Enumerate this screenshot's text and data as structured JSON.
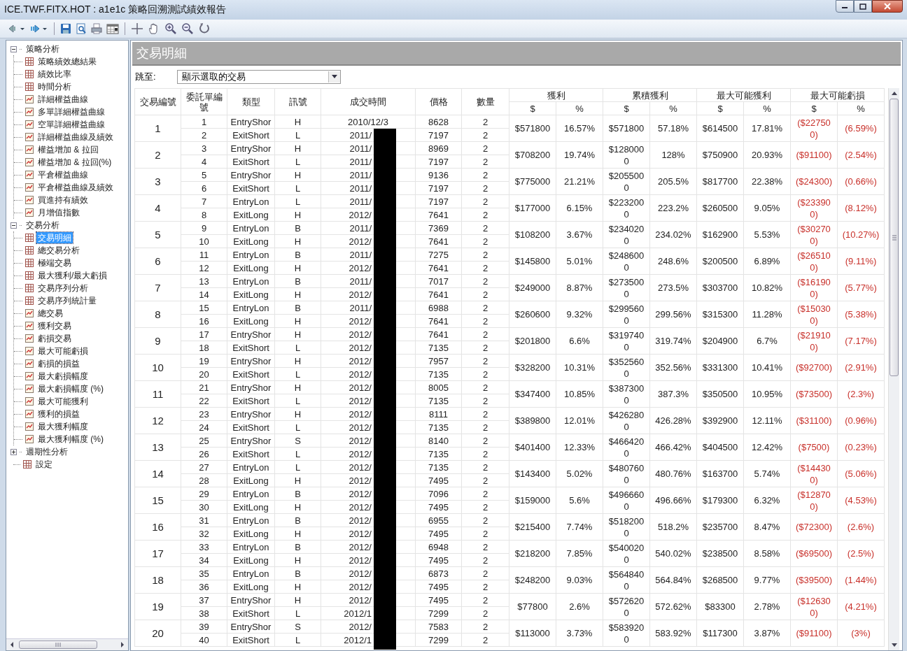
{
  "window": {
    "title": "ICE.TWF.FITX.HOT : a1e1c 策略回溯測試績效報告"
  },
  "sidebar": {
    "items": [
      {
        "label": "策略分析",
        "expanded": true,
        "selected": false,
        "children": [
          {
            "label": "策略績效總結果",
            "kind": "table",
            "selected": false
          },
          {
            "label": "績效比率",
            "kind": "table",
            "selected": false
          },
          {
            "label": "時間分析",
            "kind": "table",
            "selected": false
          },
          {
            "label": "詳細權益曲線",
            "kind": "chart",
            "selected": false
          },
          {
            "label": "多單詳細權益曲線",
            "kind": "chart",
            "selected": false
          },
          {
            "label": "空單詳細權益曲線",
            "kind": "chart",
            "selected": false
          },
          {
            "label": "詳細權益曲線及績效",
            "kind": "chart",
            "selected": false
          },
          {
            "label": "權益增加 & 拉回",
            "kind": "chart",
            "selected": false
          },
          {
            "label": "權益增加 & 拉回(%)",
            "kind": "chart",
            "selected": false
          },
          {
            "label": "平倉權益曲線",
            "kind": "chart",
            "selected": false
          },
          {
            "label": "平倉權益曲線及績效",
            "kind": "chart",
            "selected": false
          },
          {
            "label": "買進持有績效",
            "kind": "chart",
            "selected": false
          },
          {
            "label": "月增值指數",
            "kind": "chart",
            "selected": false
          }
        ]
      },
      {
        "label": "交易分析",
        "expanded": true,
        "selected": false,
        "children": [
          {
            "label": "交易明細",
            "kind": "table",
            "selected": true
          },
          {
            "label": "總交易分析",
            "kind": "table",
            "selected": false
          },
          {
            "label": "極端交易",
            "kind": "table",
            "selected": false
          },
          {
            "label": "最大獲利/最大虧損",
            "kind": "table",
            "selected": false
          },
          {
            "label": "交易序列分析",
            "kind": "table",
            "selected": false
          },
          {
            "label": "交易序列統計量",
            "kind": "table",
            "selected": false
          },
          {
            "label": "總交易",
            "kind": "chart",
            "selected": false
          },
          {
            "label": "獲利交易",
            "kind": "chart",
            "selected": false
          },
          {
            "label": "虧損交易",
            "kind": "chart",
            "selected": false
          },
          {
            "label": "最大可能虧損",
            "kind": "chart",
            "selected": false
          },
          {
            "label": "虧損的損益",
            "kind": "chart",
            "selected": false
          },
          {
            "label": "最大虧損幅度",
            "kind": "chart",
            "selected": false
          },
          {
            "label": "最大虧損幅度 (%)",
            "kind": "chart",
            "selected": false
          },
          {
            "label": "最大可能獲利",
            "kind": "chart",
            "selected": false
          },
          {
            "label": "獲利的損益",
            "kind": "chart",
            "selected": false
          },
          {
            "label": "最大獲利幅度",
            "kind": "chart",
            "selected": false
          },
          {
            "label": "最大獲利幅度 (%)",
            "kind": "chart",
            "selected": false
          }
        ]
      },
      {
        "label": "週期性分析",
        "expanded": false,
        "selected": false
      },
      {
        "label": "設定",
        "kind": "table",
        "selected": false
      }
    ]
  },
  "report": {
    "title": "交易明細",
    "jump": {
      "label": "跳至:",
      "value": "顯示選取的交易"
    },
    "table": {
      "columns": [
        "交易編號",
        "委託單編號",
        "類型",
        "訊號",
        "成交時間",
        "價格",
        "數量"
      ],
      "groups": [
        {
          "label": "獲利",
          "negative": false,
          "subcolumns": [
            "$",
            "%"
          ]
        },
        {
          "label": "累積獲利",
          "negative": false,
          "subcolumns": [
            "$",
            "%"
          ]
        },
        {
          "label": "最大可能獲利",
          "negative": false,
          "subcolumns": [
            "$",
            "%"
          ]
        },
        {
          "label": "最大可能虧損",
          "negative": true,
          "subcolumns": [
            "$",
            "%"
          ]
        }
      ],
      "trades": [
        {
          "id": "1",
          "orders": [
            {
              "no": "1",
              "type": "EntryShor",
              "signal": "H",
              "time": "2010/12/3",
              "redacted": false,
              "price": "8628",
              "qty": "2"
            },
            {
              "no": "2",
              "type": "ExitShort",
              "signal": "L",
              "time": "2011/",
              "redacted": true,
              "price": "7197",
              "qty": "2"
            }
          ],
          "values": [
            "$571800",
            "16.57%",
            "$571800",
            "57.18%",
            "$614500",
            "17.81%",
            "($227500)",
            "(6.59%)"
          ]
        },
        {
          "id": "2",
          "orders": [
            {
              "no": "3",
              "type": "EntryShor",
              "signal": "H",
              "time": "2011/",
              "redacted": true,
              "price": "8969",
              "qty": "2"
            },
            {
              "no": "4",
              "type": "ExitShort",
              "signal": "L",
              "time": "2011/",
              "redacted": true,
              "price": "7197",
              "qty": "2"
            }
          ],
          "values": [
            "$708200",
            "19.74%",
            "$1280000",
            "128%",
            "$750900",
            "20.93%",
            "($91100)",
            "(2.54%)"
          ]
        },
        {
          "id": "3",
          "orders": [
            {
              "no": "5",
              "type": "EntryShor",
              "signal": "H",
              "time": "2011/",
              "redacted": true,
              "price": "9136",
              "qty": "2"
            },
            {
              "no": "6",
              "type": "ExitShort",
              "signal": "L",
              "time": "2011/",
              "redacted": true,
              "price": "7197",
              "qty": "2"
            }
          ],
          "values": [
            "$775000",
            "21.21%",
            "$2055000",
            "205.5%",
            "$817700",
            "22.38%",
            "($24300)",
            "(0.66%)"
          ]
        },
        {
          "id": "4",
          "orders": [
            {
              "no": "7",
              "type": "EntryLon",
              "signal": "L",
              "time": "2011/",
              "redacted": true,
              "price": "7197",
              "qty": "2"
            },
            {
              "no": "8",
              "type": "ExitLong",
              "signal": "H",
              "time": "2012/",
              "redacted": true,
              "price": "7641",
              "qty": "2"
            }
          ],
          "values": [
            "$177000",
            "6.15%",
            "$2232000",
            "223.2%",
            "$260500",
            "9.05%",
            "($233900)",
            "(8.12%)"
          ]
        },
        {
          "id": "5",
          "orders": [
            {
              "no": "9",
              "type": "EntryLon",
              "signal": "B",
              "time": "2011/",
              "redacted": true,
              "price": "7369",
              "qty": "2"
            },
            {
              "no": "10",
              "type": "ExitLong",
              "signal": "H",
              "time": "2012/",
              "redacted": true,
              "price": "7641",
              "qty": "2"
            }
          ],
          "values": [
            "$108200",
            "3.67%",
            "$2340200",
            "234.02%",
            "$162900",
            "5.53%",
            "($302700)",
            "(10.27%)"
          ]
        },
        {
          "id": "6",
          "orders": [
            {
              "no": "11",
              "type": "EntryLon",
              "signal": "B",
              "time": "2011/",
              "redacted": true,
              "price": "7275",
              "qty": "2"
            },
            {
              "no": "12",
              "type": "ExitLong",
              "signal": "H",
              "time": "2012/",
              "redacted": true,
              "price": "7641",
              "qty": "2"
            }
          ],
          "values": [
            "$145800",
            "5.01%",
            "$2486000",
            "248.6%",
            "$200500",
            "6.89%",
            "($265100)",
            "(9.11%)"
          ]
        },
        {
          "id": "7",
          "orders": [
            {
              "no": "13",
              "type": "EntryLon",
              "signal": "B",
              "time": "2011/",
              "redacted": true,
              "price": "7017",
              "qty": "2"
            },
            {
              "no": "14",
              "type": "ExitLong",
              "signal": "H",
              "time": "2012/",
              "redacted": true,
              "price": "7641",
              "qty": "2"
            }
          ],
          "values": [
            "$249000",
            "8.87%",
            "$2735000",
            "273.5%",
            "$303700",
            "10.82%",
            "($161900)",
            "(5.77%)"
          ]
        },
        {
          "id": "8",
          "orders": [
            {
              "no": "15",
              "type": "EntryLon",
              "signal": "B",
              "time": "2011/",
              "redacted": true,
              "price": "6988",
              "qty": "2"
            },
            {
              "no": "16",
              "type": "ExitLong",
              "signal": "H",
              "time": "2012/",
              "redacted": true,
              "price": "7641",
              "qty": "2"
            }
          ],
          "values": [
            "$260600",
            "9.32%",
            "$2995600",
            "299.56%",
            "$315300",
            "11.28%",
            "($150300)",
            "(5.38%)"
          ]
        },
        {
          "id": "9",
          "orders": [
            {
              "no": "17",
              "type": "EntryShor",
              "signal": "H",
              "time": "2012/",
              "redacted": true,
              "price": "7641",
              "qty": "2"
            },
            {
              "no": "18",
              "type": "ExitShort",
              "signal": "L",
              "time": "2012/",
              "redacted": true,
              "price": "7135",
              "qty": "2"
            }
          ],
          "values": [
            "$201800",
            "6.6%",
            "$3197400",
            "319.74%",
            "$204900",
            "6.7%",
            "($219100)",
            "(7.17%)"
          ]
        },
        {
          "id": "10",
          "orders": [
            {
              "no": "19",
              "type": "EntryShor",
              "signal": "H",
              "time": "2012/",
              "redacted": true,
              "price": "7957",
              "qty": "2"
            },
            {
              "no": "20",
              "type": "ExitShort",
              "signal": "L",
              "time": "2012/",
              "redacted": true,
              "price": "7135",
              "qty": "2"
            }
          ],
          "values": [
            "$328200",
            "10.31%",
            "$3525600",
            "352.56%",
            "$331300",
            "10.41%",
            "($92700)",
            "(2.91%)"
          ]
        },
        {
          "id": "11",
          "orders": [
            {
              "no": "21",
              "type": "EntryShor",
              "signal": "H",
              "time": "2012/",
              "redacted": true,
              "price": "8005",
              "qty": "2"
            },
            {
              "no": "22",
              "type": "ExitShort",
              "signal": "L",
              "time": "2012/",
              "redacted": true,
              "price": "7135",
              "qty": "2"
            }
          ],
          "values": [
            "$347400",
            "10.85%",
            "$3873000",
            "387.3%",
            "$350500",
            "10.95%",
            "($73500)",
            "(2.3%)"
          ]
        },
        {
          "id": "12",
          "orders": [
            {
              "no": "23",
              "type": "EntryShor",
              "signal": "H",
              "time": "2012/",
              "redacted": true,
              "price": "8111",
              "qty": "2"
            },
            {
              "no": "24",
              "type": "ExitShort",
              "signal": "L",
              "time": "2012/",
              "redacted": true,
              "price": "7135",
              "qty": "2"
            }
          ],
          "values": [
            "$389800",
            "12.01%",
            "$4262800",
            "426.28%",
            "$392900",
            "12.11%",
            "($31100)",
            "(0.96%)"
          ]
        },
        {
          "id": "13",
          "orders": [
            {
              "no": "25",
              "type": "EntryShor",
              "signal": "S",
              "time": "2012/",
              "redacted": true,
              "price": "8140",
              "qty": "2"
            },
            {
              "no": "26",
              "type": "ExitShort",
              "signal": "L",
              "time": "2012/",
              "redacted": true,
              "price": "7135",
              "qty": "2"
            }
          ],
          "values": [
            "$401400",
            "12.33%",
            "$4664200",
            "466.42%",
            "$404500",
            "12.42%",
            "($7500)",
            "(0.23%)"
          ]
        },
        {
          "id": "14",
          "orders": [
            {
              "no": "27",
              "type": "EntryLon",
              "signal": "L",
              "time": "2012/",
              "redacted": true,
              "price": "7135",
              "qty": "2"
            },
            {
              "no": "28",
              "type": "ExitLong",
              "signal": "H",
              "time": "2012/",
              "redacted": true,
              "price": "7495",
              "qty": "2"
            }
          ],
          "values": [
            "$143400",
            "5.02%",
            "$4807600",
            "480.76%",
            "$163700",
            "5.74%",
            "($144300)",
            "(5.06%)"
          ]
        },
        {
          "id": "15",
          "orders": [
            {
              "no": "29",
              "type": "EntryLon",
              "signal": "B",
              "time": "2012/",
              "redacted": true,
              "price": "7096",
              "qty": "2"
            },
            {
              "no": "30",
              "type": "ExitLong",
              "signal": "H",
              "time": "2012/",
              "redacted": true,
              "price": "7495",
              "qty": "2"
            }
          ],
          "values": [
            "$159000",
            "5.6%",
            "$4966600",
            "496.66%",
            "$179300",
            "6.32%",
            "($128700)",
            "(4.53%)"
          ]
        },
        {
          "id": "16",
          "orders": [
            {
              "no": "31",
              "type": "EntryLon",
              "signal": "B",
              "time": "2012/",
              "redacted": true,
              "price": "6955",
              "qty": "2"
            },
            {
              "no": "32",
              "type": "ExitLong",
              "signal": "H",
              "time": "2012/",
              "redacted": true,
              "price": "7495",
              "qty": "2"
            }
          ],
          "values": [
            "$215400",
            "7.74%",
            "$5182000",
            "518.2%",
            "$235700",
            "8.47%",
            "($72300)",
            "(2.6%)"
          ]
        },
        {
          "id": "17",
          "orders": [
            {
              "no": "33",
              "type": "EntryLon",
              "signal": "B",
              "time": "2012/",
              "redacted": true,
              "price": "6948",
              "qty": "2"
            },
            {
              "no": "34",
              "type": "ExitLong",
              "signal": "H",
              "time": "2012/",
              "redacted": true,
              "price": "7495",
              "qty": "2"
            }
          ],
          "values": [
            "$218200",
            "7.85%",
            "$5400200",
            "540.02%",
            "$238500",
            "8.58%",
            "($69500)",
            "(2.5%)"
          ]
        },
        {
          "id": "18",
          "orders": [
            {
              "no": "35",
              "type": "EntryLon",
              "signal": "B",
              "time": "2012/",
              "redacted": true,
              "price": "6873",
              "qty": "2"
            },
            {
              "no": "36",
              "type": "ExitLong",
              "signal": "H",
              "time": "2012/",
              "redacted": true,
              "price": "7495",
              "qty": "2"
            }
          ],
          "values": [
            "$248200",
            "9.03%",
            "$5648400",
            "564.84%",
            "$268500",
            "9.77%",
            "($39500)",
            "(1.44%)"
          ]
        },
        {
          "id": "19",
          "orders": [
            {
              "no": "37",
              "type": "EntryShor",
              "signal": "H",
              "time": "2012/",
              "redacted": true,
              "price": "7495",
              "qty": "2"
            },
            {
              "no": "38",
              "type": "ExitShort",
              "signal": "L",
              "time": "2012/1",
              "redacted": true,
              "price": "7299",
              "qty": "2"
            }
          ],
          "values": [
            "$77800",
            "2.6%",
            "$5726200",
            "572.62%",
            "$83300",
            "2.78%",
            "($126300)",
            "(4.21%)"
          ]
        },
        {
          "id": "20",
          "orders": [
            {
              "no": "39",
              "type": "EntryShor",
              "signal": "S",
              "time": "2012/",
              "redacted": true,
              "price": "7583",
              "qty": "2"
            },
            {
              "no": "40",
              "type": "ExitShort",
              "signal": "L",
              "time": "2012/1",
              "redacted": true,
              "price": "7299",
              "qty": "2"
            }
          ],
          "values": [
            "$113000",
            "3.73%",
            "$5839200",
            "583.92%",
            "$117300",
            "3.87%",
            "($91100)",
            "(3%)"
          ]
        }
      ]
    }
  }
}
